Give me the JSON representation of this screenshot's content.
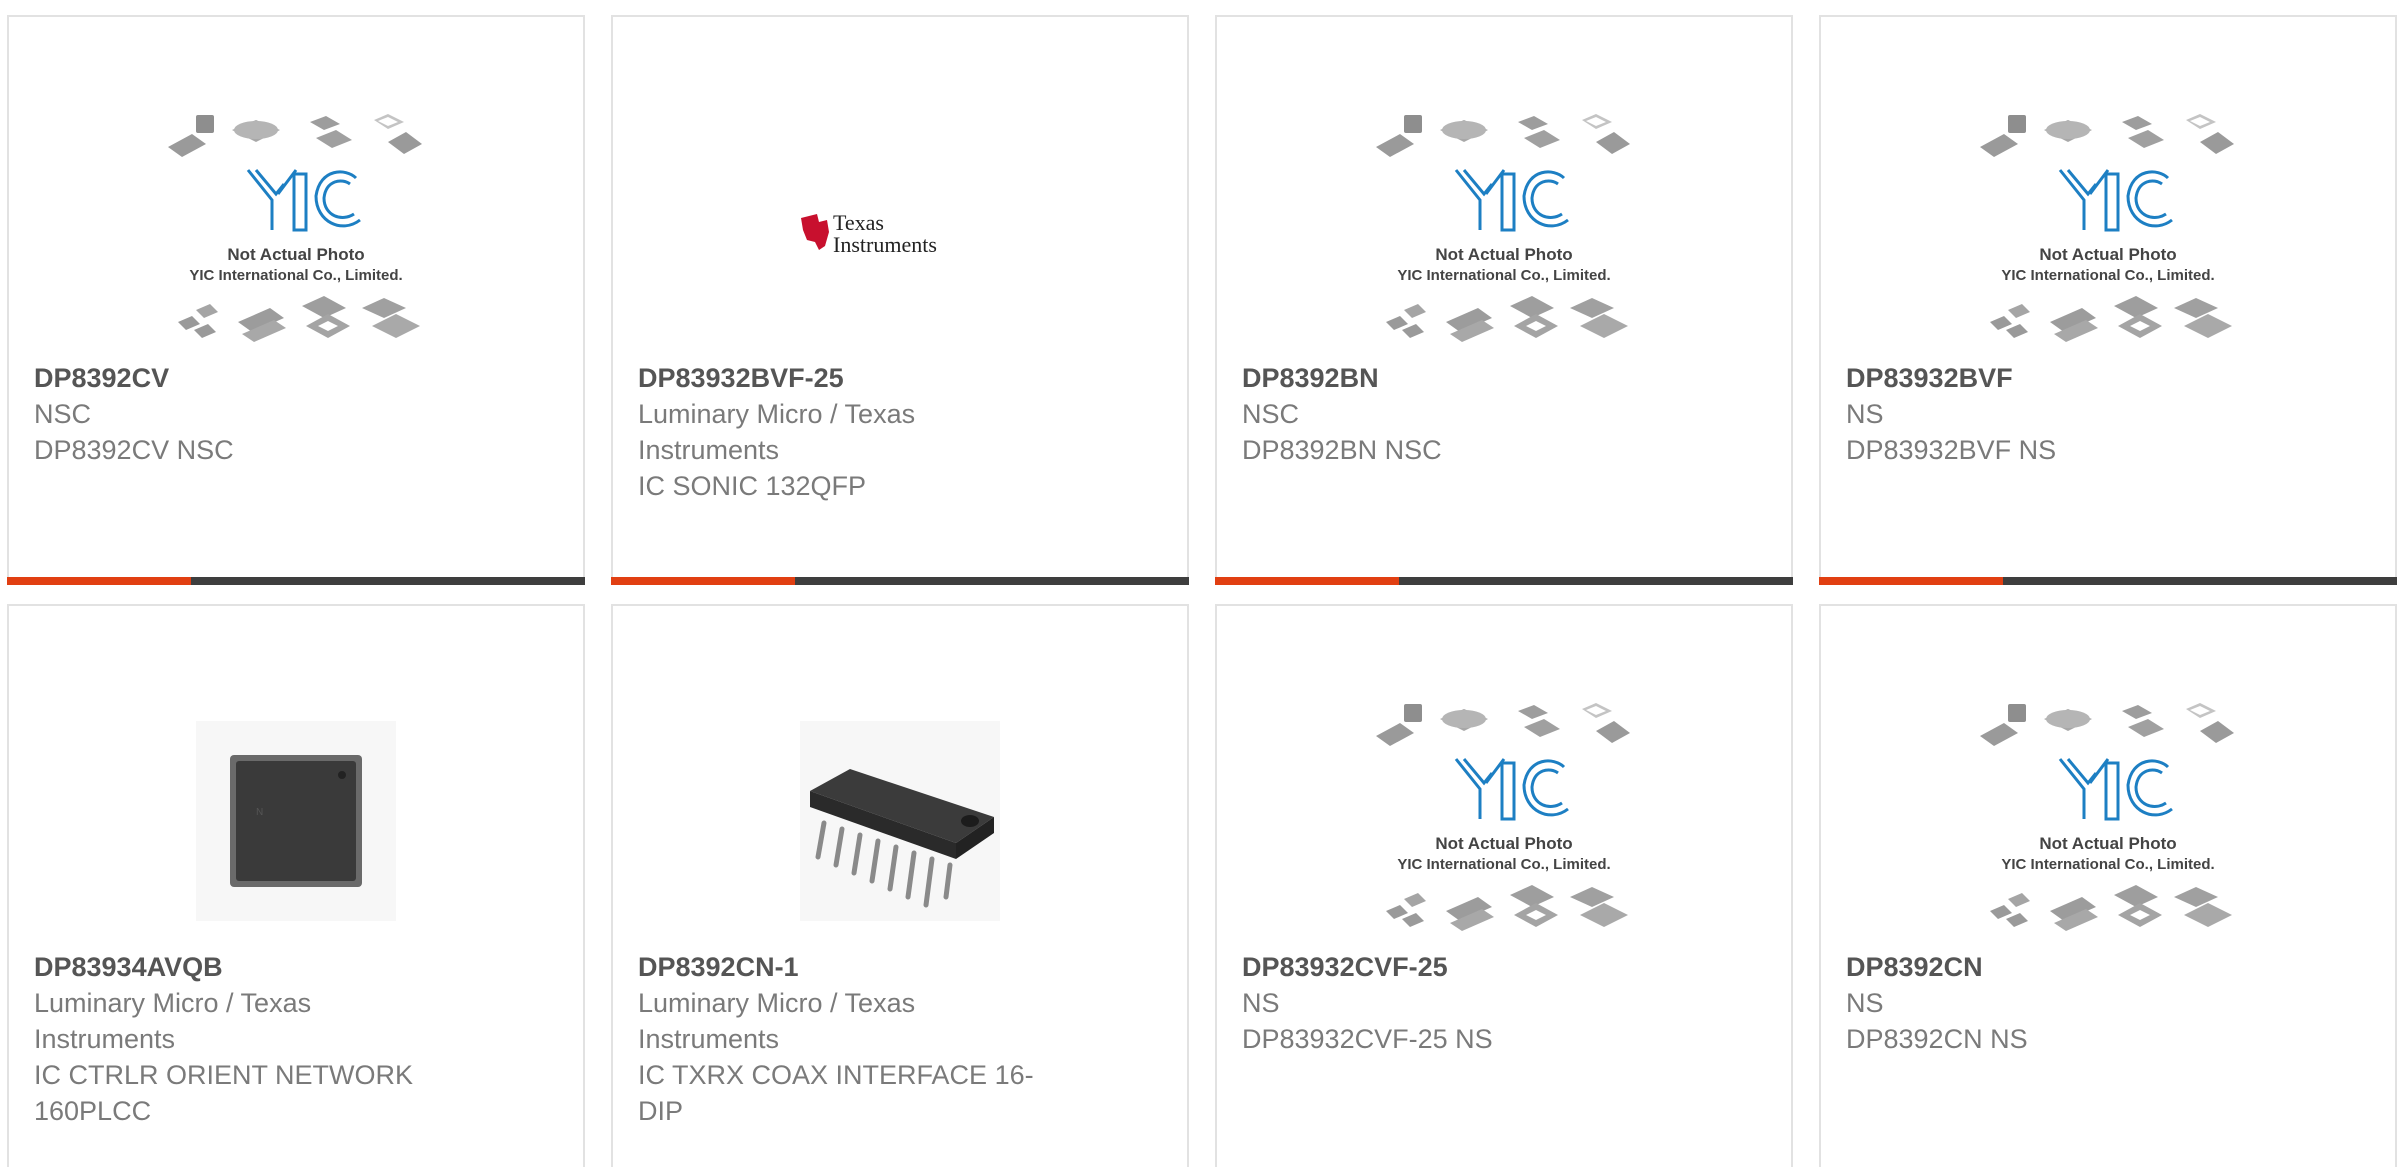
{
  "placeholder": {
    "brand": "YIC",
    "caption_line1": "Not Actual Photo",
    "caption_line2": "YIC International Co., Limited."
  },
  "ti_logo": {
    "line1": "Texas",
    "line2": "Instruments"
  },
  "colors": {
    "accent": "#e13f12",
    "bar": "#3e3e3e",
    "border": "#e2e2e2",
    "part_number": "#555555",
    "text": "#7a7a7a",
    "yic_blue": "#1d7fc3"
  },
  "products": [
    {
      "part_number": "DP8392CV",
      "manufacturer": "NSC",
      "description": "DP8392CV NSC",
      "image": "yic-placeholder"
    },
    {
      "part_number": "DP83932BVF-25",
      "manufacturer": "Luminary Micro / Texas Instruments",
      "description": "IC SONIC 132QFP",
      "image": "texas-instruments-logo"
    },
    {
      "part_number": "DP8392BN",
      "manufacturer": "NSC",
      "description": "DP8392BN NSC",
      "image": "yic-placeholder"
    },
    {
      "part_number": "DP83932BVF",
      "manufacturer": "NS",
      "description": "DP83932BVF NS",
      "image": "yic-placeholder"
    },
    {
      "part_number": "DP83934AVQB",
      "manufacturer": "Luminary Micro / Texas Instruments",
      "description": "IC CTRLR ORIENT NETWORK 160PLCC",
      "image": "plcc-chip-photo"
    },
    {
      "part_number": "DP8392CN-1",
      "manufacturer": "Luminary Micro / Texas Instruments",
      "description": "IC TXRX COAX INTERFACE 16-DIP",
      "image": "dip-chip-photo"
    },
    {
      "part_number": "DP83932CVF-25",
      "manufacturer": "NS",
      "description": "DP83932CVF-25 NS",
      "image": "yic-placeholder"
    },
    {
      "part_number": "DP8392CN",
      "manufacturer": "NS",
      "description": "DP8392CN NS",
      "image": "yic-placeholder"
    }
  ]
}
